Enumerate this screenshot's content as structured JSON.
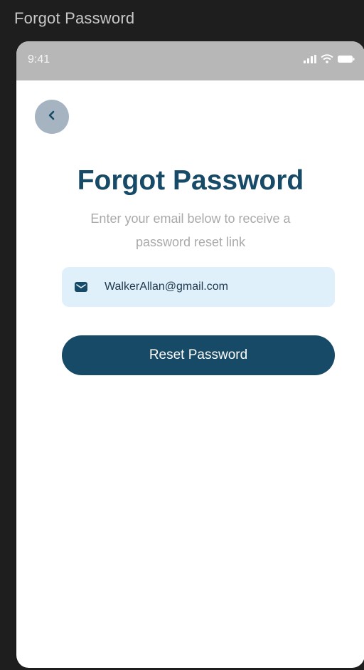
{
  "frame": {
    "title": "Forgot Password"
  },
  "status_bar": {
    "time": "9:41",
    "icons": [
      "signal-icon",
      "wifi-icon",
      "battery-icon"
    ]
  },
  "back_button": {
    "icon": "chevron-left-icon"
  },
  "header": {
    "title": "Forgot Password",
    "subtitle_line1": "Enter your email below to receive a",
    "subtitle_line2": "password reset link"
  },
  "email": {
    "icon": "mail-icon",
    "value": "WalkerAllan@gmail.com"
  },
  "actions": {
    "reset_label": "Reset Password"
  },
  "colors": {
    "primary": "#174a66",
    "field_bg": "#dff0fb",
    "back_bg": "#a6b4c2",
    "status_bg": "#b7b7b7",
    "subtitle": "#a9a9a9"
  }
}
